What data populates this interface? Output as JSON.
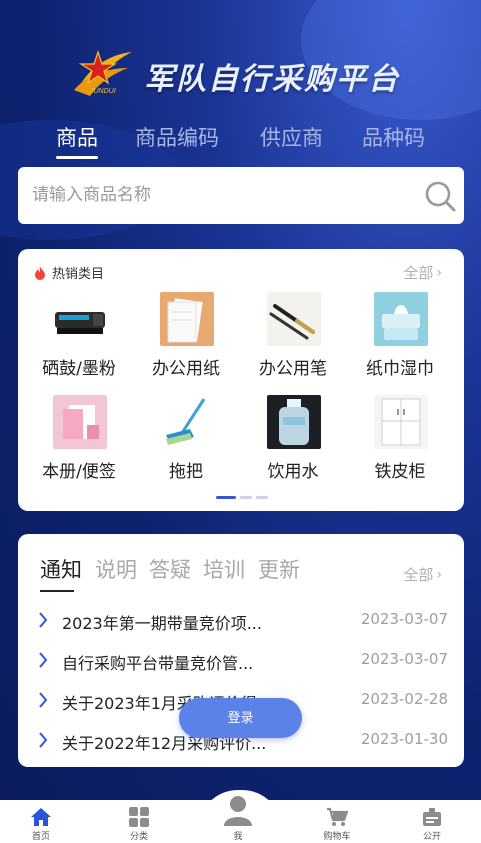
{
  "header": {
    "app_title": "军队自行采购平台",
    "logo_text": "JUNDUI"
  },
  "tabs": [
    {
      "label": "商品",
      "active": true
    },
    {
      "label": "商品编码",
      "active": false
    },
    {
      "label": "供应商",
      "active": false
    },
    {
      "label": "品种码",
      "active": false
    }
  ],
  "search": {
    "placeholder": "请输入商品名称",
    "value": ""
  },
  "hot": {
    "title": "热销类目",
    "all_label": "全部",
    "categories": [
      {
        "label": "硒鼓/墨粉",
        "icon": "toner-cartridge"
      },
      {
        "label": "办公用纸",
        "icon": "office-paper"
      },
      {
        "label": "办公用笔",
        "icon": "pen"
      },
      {
        "label": "纸巾湿巾",
        "icon": "tissue"
      },
      {
        "label": "本册/便签",
        "icon": "notebook"
      },
      {
        "label": "拖把",
        "icon": "mop"
      },
      {
        "label": "饮用水",
        "icon": "water-bottle"
      },
      {
        "label": "铁皮柜",
        "icon": "cabinet"
      }
    ],
    "page_index": 0,
    "page_count": 3
  },
  "notice": {
    "tabs": [
      "通知",
      "说明",
      "答疑",
      "培训",
      "更新"
    ],
    "active_tab": 0,
    "all_label": "全部",
    "items": [
      {
        "text": "2023年第一期带量竞价项...",
        "date": "2023-03-07"
      },
      {
        "text": "自行采购平台带量竞价管...",
        "date": "2023-03-07"
      },
      {
        "text": "关于2023年1月采购评价得...",
        "date": "2023-02-28"
      },
      {
        "text": "关于2022年12月采购评价...",
        "date": "2023-01-30"
      }
    ]
  },
  "login_label": "登录",
  "bottom_nav": [
    {
      "label": "首页",
      "icon": "home-icon",
      "active": true
    },
    {
      "label": "分类",
      "icon": "grid-icon",
      "active": false
    },
    {
      "label": "我",
      "icon": "user-icon",
      "active": false
    },
    {
      "label": "购物车",
      "icon": "cart-icon",
      "active": false
    },
    {
      "label": "公开",
      "icon": "public-icon",
      "active": false
    }
  ],
  "colors": {
    "primary": "#3357d6",
    "nav_active": "#2b55d8",
    "background": "#0d2370",
    "button": "#5b82e8"
  }
}
